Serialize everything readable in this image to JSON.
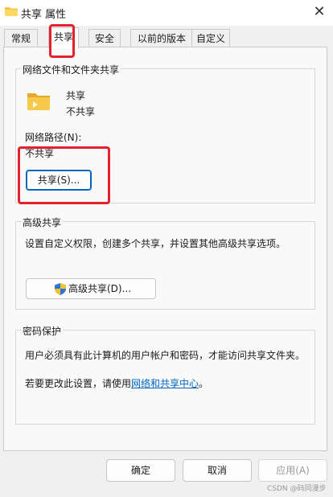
{
  "window": {
    "title": "共享 属性",
    "close_glyph": "✕"
  },
  "tabs": [
    {
      "label": "常规"
    },
    {
      "label": "共享"
    },
    {
      "label": "安全"
    },
    {
      "label": "以前的版本"
    },
    {
      "label": "自定义"
    }
  ],
  "network_sharing": {
    "group_title": "网络文件和文件夹共享",
    "folder_name": "共享",
    "status": "不共享",
    "path_label": "网络路径(N):",
    "path_value": "不共享",
    "share_button": "共享(S)..."
  },
  "advanced_sharing": {
    "group_title": "高级共享",
    "description": "设置自定义权限，创建多个共享，并设置其他高级共享选项。",
    "button": "高级共享(D)..."
  },
  "password_protection": {
    "group_title": "密码保护",
    "description": "用户必须具有此计算机的用户帐户和密码，才能访问共享文件夹。",
    "change_prefix": "若要更改此设置，请使用",
    "link": "网络和共享中心",
    "change_suffix": "。"
  },
  "buttons": {
    "ok": "确定",
    "cancel": "取消",
    "apply": "应用(A)"
  },
  "watermark": "CSDN @码同漫步",
  "colors": {
    "highlight": "#e4222f",
    "accent": "#0067c0",
    "folder": "#f5c542"
  }
}
